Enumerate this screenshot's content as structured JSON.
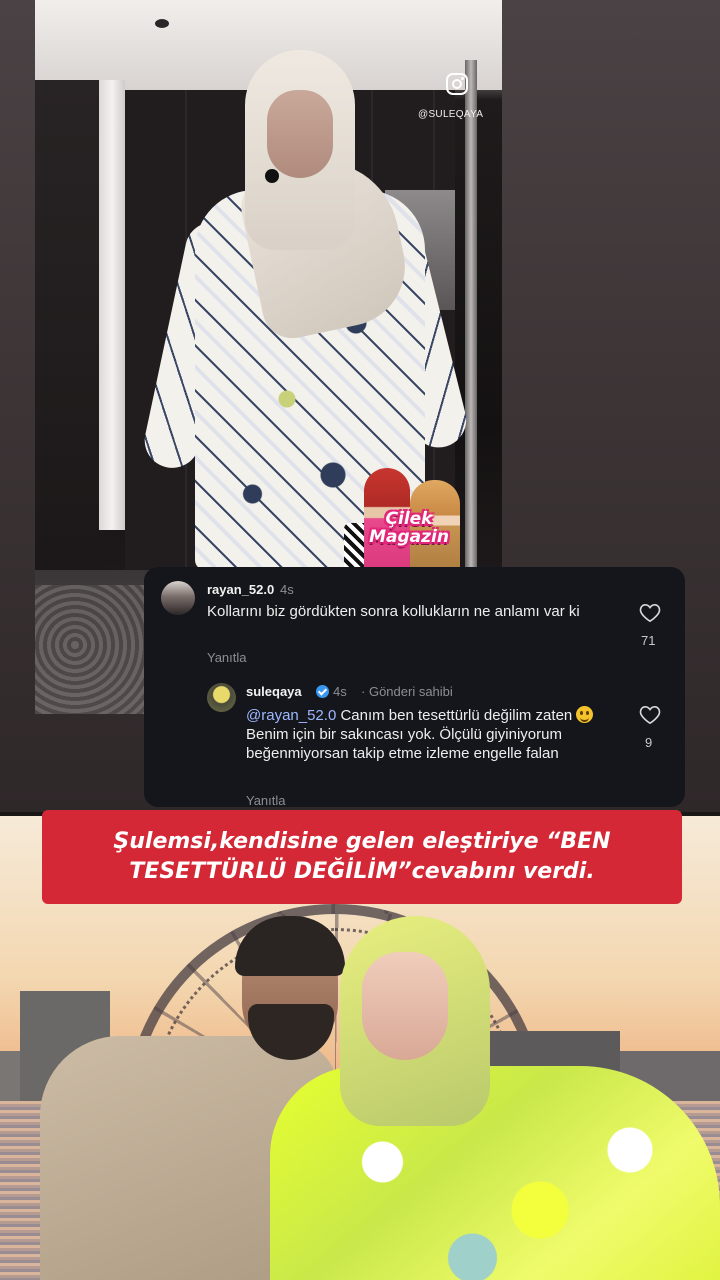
{
  "video": {
    "watermark_handle": "@SULEQAYA",
    "logo_text_line1": "Çilek",
    "logo_text_line2": "Magazin"
  },
  "comments": [
    {
      "username": "rayan_52.0",
      "time": "4s",
      "text": "Kollarını biz gördükten sonra kollukların ne anlamı var ki",
      "reply_label": "Yanıtla",
      "likes": "71"
    },
    {
      "username": "suleqaya",
      "verified": true,
      "time": "4s",
      "owner_label": "Gönderi sahibi",
      "mention": "@rayan_52.0",
      "text_part1": " Canım ben tesettürlü değilim zaten ",
      "text_part2": " Benim için bir sakıncası yok. Ölçülü giyiniyorum beğenmiyorsan takip etme izleme engelle falan",
      "reply_label": "Yanıtla",
      "likes": "9"
    }
  ],
  "headline": {
    "text": "Şulemsi,kendisine gelen eleştiriye “BEN TESETTÜRLÜ DEĞİLİM”cevabını verdi."
  },
  "colors": {
    "headline_bg": "#d42836",
    "panel_bg": "#15161b",
    "mention": "#9db8ff",
    "verified": "#3897f0"
  }
}
